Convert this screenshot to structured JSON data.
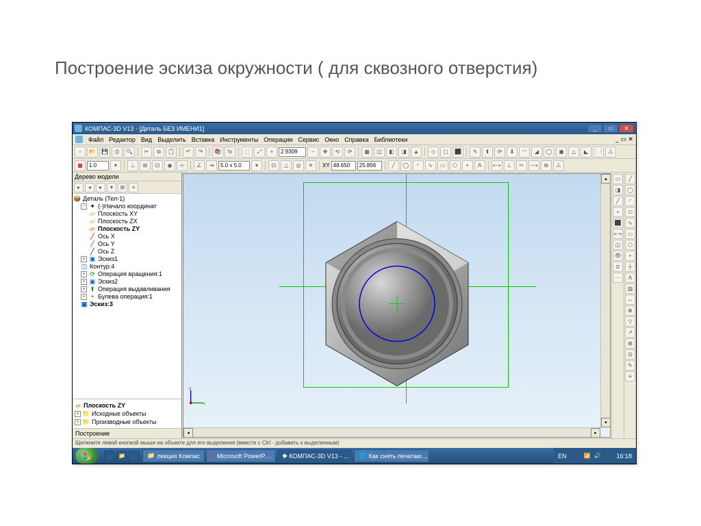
{
  "slide_title": "Построение эскиза окружности ( для сквозного отверстия)",
  "window": {
    "app_title": "КОМПАС-3D V13 - [Деталь БЕЗ ИМЕНИ1]",
    "minimize": "_",
    "maximize": "▭",
    "close": "✕",
    "doc_close": "✕"
  },
  "menu": {
    "file": "Файл",
    "edit": "Редактор",
    "view": "Вид",
    "select": "Выделить",
    "insert": "Вставка",
    "tools": "Инструменты",
    "ops": "Операции",
    "service": "Сервис",
    "window": "Окно",
    "help": "Справка",
    "lib": "Библиотеки"
  },
  "tb1": {
    "scale_value": "1.0",
    "grid_value": "5.0 x 5.0",
    "coord_x": "48.650",
    "coord_y": "25.856",
    "zoom_readout": "2.9309"
  },
  "tree": {
    "panel_title": "Дерево модели",
    "root": "Деталь (Тел-1)",
    "origin": "(-)Начало координат",
    "plane_xy": "Плоскость XY",
    "plane_zx": "Плоскость ZX",
    "plane_zy": "Плоскость ZY",
    "axis_x": "Ось X",
    "axis_y": "Ось Y",
    "axis_z": "Ось Z",
    "sketch1": "Эскиз1",
    "contour4": "Контур:4",
    "op_rev": "Операция вращения:1",
    "sketch2": "Эскиз2",
    "op_ext": "Операция выдавливания",
    "bool1": "Булева операция:1",
    "sketch3": "Эскиз:3",
    "bottom_plane": "Плоскость ZY",
    "src_objects": "Исходные объекты",
    "derived": "Производные объекты",
    "tab": "Построение"
  },
  "status": "Щелкните левой кнопкой мыши на объекте для его выделения (вместе с Ctrl - добавить к выделенным)",
  "taskbar": {
    "t1": "лекция Компас",
    "t2": "Microsoft PowerP…",
    "t3": "КОМПАС-3D V13 - …",
    "t4": "Как снять печатаю…",
    "lang": "EN",
    "clock": "16:18"
  },
  "ucs_z": "Z",
  "ucs_y": "Y"
}
